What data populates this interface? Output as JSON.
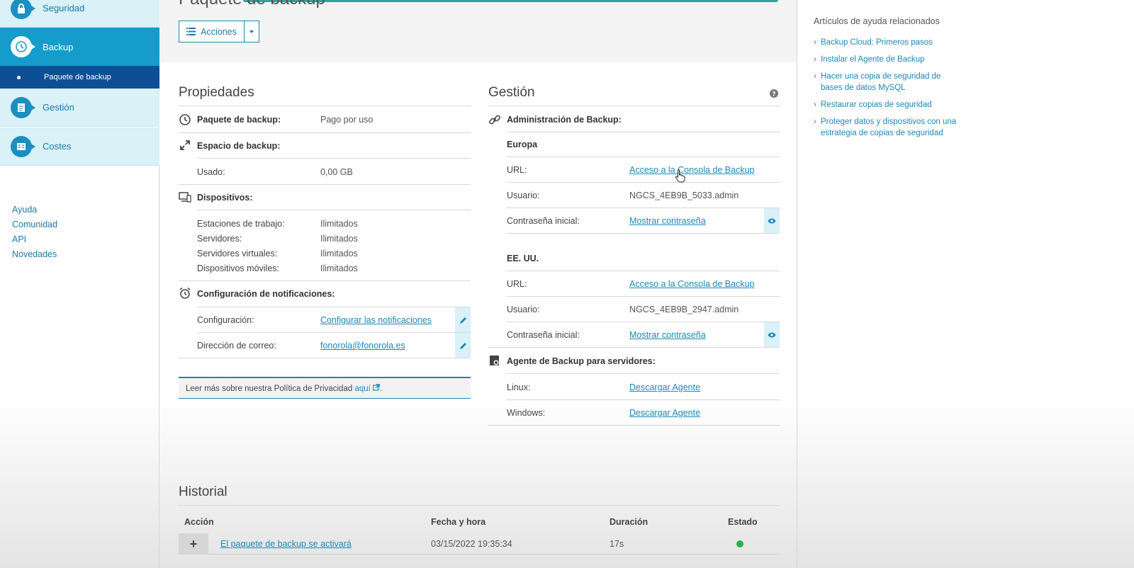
{
  "sidebar": {
    "items": [
      {
        "label": "Seguridad"
      },
      {
        "label": "Backup"
      },
      {
        "label": "Paquete de backup"
      },
      {
        "label": "Gestión"
      },
      {
        "label": "Costes"
      }
    ],
    "links": [
      "Ayuda",
      "Comunidad",
      "API",
      "Novedades"
    ]
  },
  "header": {
    "title": "Paquete de backup",
    "actions_label": "Acciones"
  },
  "propiedades": {
    "title": "Propiedades",
    "paquete_label": "Paquete de backup:",
    "paquete_value": "Pago por uso",
    "espacio_label": "Espacio de backup:",
    "usado_label": "Usado:",
    "usado_value": "0,00 GB",
    "dispositivos_label": "Dispositivos:",
    "estaciones_label": "Estaciones de trabajo:",
    "estaciones_value": "Ilimitados",
    "servidores_label": "Servidores:",
    "servidores_value": "Ilimitados",
    "virtuales_label": "Servidores virtuales:",
    "virtuales_value": "Ilimitados",
    "moviles_label": "Dispositivos móviles:",
    "moviles_value": "Ilimitados",
    "notif_label": "Configuración de notificaciones:",
    "config_label": "Configuración:",
    "config_link": "Configurar las notificaciones",
    "correo_label": "Dirección de correo:",
    "correo_link": "fonorola@fonorola.es",
    "privacy_text": "Leer más sobre nuestra Política de Privacidad",
    "privacy_link": "aquí",
    "privacy_end": "."
  },
  "gestion": {
    "title": "Gestión",
    "admin_label": "Administración de Backup:",
    "europa": "Europa",
    "url_label": "URL:",
    "url_link": "Acceso a la Consola de Backup",
    "usuario_label": "Usuario:",
    "usuario_eu": "NGCS_4EB9B_5033.admin",
    "pass_label": "Contraseña inicial:",
    "pass_link": "Mostrar contraseña",
    "usa": "EE. UU.",
    "usuario_us": "NGCS_4EB9B_2947.admin",
    "agente_label": "Agente de Backup para servidores:",
    "linux_label": "Linux:",
    "windows_label": "Windows:",
    "descargar_link": "Descargar Agente"
  },
  "help": {
    "title": "Artículos de ayuda relacionados",
    "links": [
      "Backup Cloud: Primeros pasos",
      "Instalar el Agente de Backup",
      "Hacer una copia de seguridad de bases de datos MySQL",
      "Restaurar copias de seguridad",
      "Proteger datos y dispositivos con una estrategia de copias de seguridad"
    ]
  },
  "historial": {
    "title": "Historial",
    "columns": [
      "Acción",
      "Fecha y hora",
      "Duración",
      "Estado"
    ],
    "rows": [
      {
        "accion": "El paquete de backup se activará",
        "fecha": "03/15/2022 19:35:34",
        "duracion": "17s",
        "estado_color": "#2ab24a"
      }
    ]
  }
}
